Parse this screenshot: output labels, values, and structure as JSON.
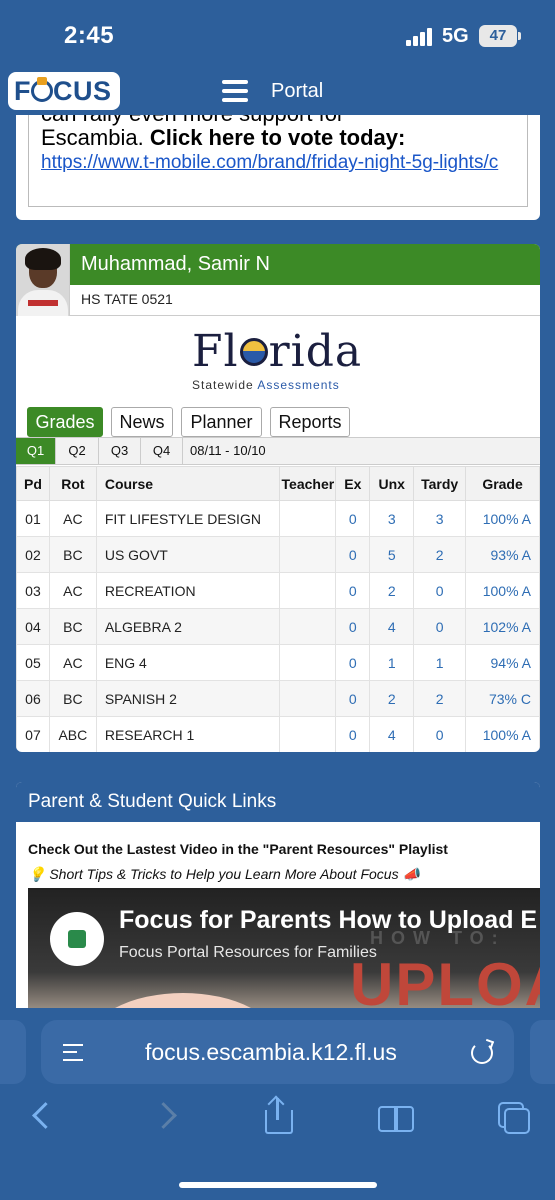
{
  "status_bar": {
    "time": "2:45",
    "network": "5G",
    "battery": "47"
  },
  "nav": {
    "logo": "FOCUS",
    "title": "Portal"
  },
  "promo": {
    "cut_line": "can rally even more support for",
    "line": "Escambia.",
    "cta": "Click here to vote today:",
    "link": "https://www.t-mobile.com/brand/friday-night-5g-lights/c"
  },
  "student": {
    "name": "Muhammad, Samir N",
    "school": "HS TATE 0521"
  },
  "florida_logo": {
    "word": "Florida",
    "sub_prefix": "Statewide",
    "sub_accent": "Assessments"
  },
  "tabs": [
    "Grades",
    "News",
    "Planner",
    "Reports"
  ],
  "quarters": [
    "Q1",
    "Q2",
    "Q3",
    "Q4"
  ],
  "quarter_range": "08/11 - 10/10",
  "grades": {
    "headers": [
      "Pd",
      "Rot",
      "Course",
      "Teacher",
      "Ex",
      "Unx",
      "Tardy",
      "Grade"
    ],
    "rows": [
      {
        "pd": "01",
        "rot": "AC",
        "course": "FIT LIFESTYLE DESIGN",
        "teacher": "",
        "ex": "0",
        "unx": "3",
        "tardy": "3",
        "grade": "100% A"
      },
      {
        "pd": "02",
        "rot": "BC",
        "course": "US GOVT",
        "teacher": "",
        "ex": "0",
        "unx": "5",
        "tardy": "2",
        "grade": "93% A"
      },
      {
        "pd": "03",
        "rot": "AC",
        "course": "RECREATION",
        "teacher": "",
        "ex": "0",
        "unx": "2",
        "tardy": "0",
        "grade": "100% A"
      },
      {
        "pd": "04",
        "rot": "BC",
        "course": "ALGEBRA 2",
        "teacher": "",
        "ex": "0",
        "unx": "4",
        "tardy": "0",
        "grade": "102% A"
      },
      {
        "pd": "05",
        "rot": "AC",
        "course": "ENG 4",
        "teacher": "",
        "ex": "0",
        "unx": "1",
        "tardy": "1",
        "grade": "94% A"
      },
      {
        "pd": "06",
        "rot": "BC",
        "course": "SPANISH 2",
        "teacher": "",
        "ex": "0",
        "unx": "2",
        "tardy": "2",
        "grade": "73% C"
      },
      {
        "pd": "07",
        "rot": "ABC",
        "course": "RESEARCH 1",
        "teacher": "",
        "ex": "0",
        "unx": "4",
        "tardy": "0",
        "grade": "100% A"
      }
    ]
  },
  "quick_links": {
    "title": "Parent & Student Quick Links",
    "subtitle": "Check Out the Lastest Video in the \"Parent Resources\" Playlist",
    "tip": "💡 Short Tips & Tricks to Help you Learn More About Focus 📣",
    "video_title": "Focus for Parents How to Upload E",
    "video_subtitle": "Focus Portal Resources for Families",
    "video_overlay": "UPLOAD",
    "video_howto": "HOW TO:"
  },
  "browser": {
    "url": "focus.escambia.k12.fl.us"
  },
  "colors": {
    "header_blue": "#2d5f9b",
    "green": "#3c8a26",
    "link_blue": "#2e6db4"
  },
  "icons": [
    "signal-icon",
    "battery-icon",
    "menu-icon",
    "reader-icon",
    "reload-icon",
    "back-icon",
    "forward-icon",
    "share-icon",
    "bookmarks-icon",
    "tabs-icon"
  ]
}
